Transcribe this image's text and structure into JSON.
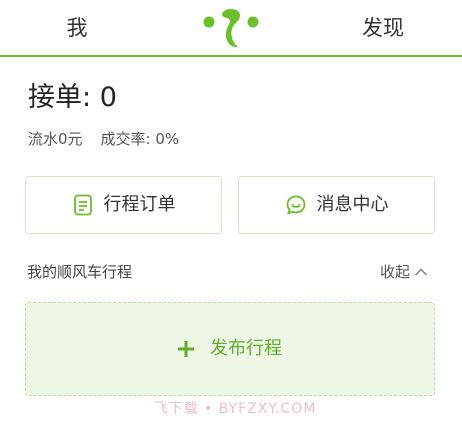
{
  "header": {
    "me_label": "我",
    "discover_label": "发现",
    "logo_icon": "sprout-logo-icon",
    "accent_color": "#6bbf2a"
  },
  "summary": {
    "orders_label": "接单",
    "orders_separator": ":",
    "orders_count": "0",
    "turnover": "流水0元",
    "success_rate": "成交率: 0%"
  },
  "actions": {
    "orders_button": {
      "label": "行程订单",
      "icon": "document-icon"
    },
    "messages_button": {
      "label": "消息中心",
      "icon": "chat-bubble-icon"
    }
  },
  "trips": {
    "section_title": "我的顺风车行程",
    "collapse_label": "收起",
    "collapse_icon": "chevron-up-icon",
    "publish_label": "发布行程",
    "publish_icon": "plus-icon"
  },
  "watermark": "飞下载 • BYFZXY.COM"
}
